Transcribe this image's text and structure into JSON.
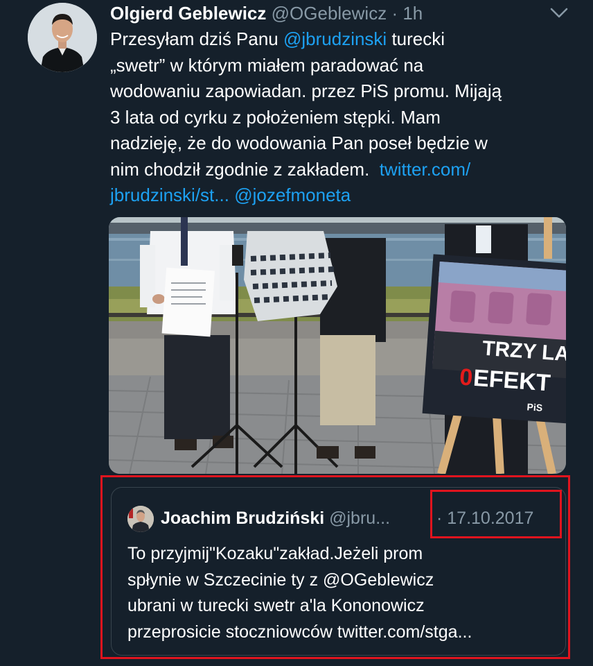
{
  "tweet": {
    "display_name": "Olgierd Geblewicz",
    "handle": "@OGeblewicz",
    "separator": "·",
    "time": "1h",
    "lines": [
      {
        "parts": [
          {
            "text": "Przesyłam dziś Panu ",
            "link": false
          },
          {
            "text": "@jbrudzinski",
            "link": true
          },
          {
            "text": " turecki",
            "link": false
          }
        ]
      },
      {
        "parts": [
          {
            "text": "„swetr” w którym miałem paradować na",
            "link": false
          }
        ]
      },
      {
        "parts": [
          {
            "text": "wodowaniu zapowiadan. przez PiS promu. Mijają",
            "link": false
          }
        ]
      },
      {
        "parts": [
          {
            "text": "3 lata od cyrku z położeniem stępki. Mam",
            "link": false
          }
        ]
      },
      {
        "parts": [
          {
            "text": "nadzieję, że do wodowania Pan poseł będzie w",
            "link": false
          }
        ]
      },
      {
        "parts": [
          {
            "text": "nim chodził zgodnie z zakładem.  ",
            "link": false
          },
          {
            "text": "twitter.com/",
            "link": true
          }
        ]
      },
      {
        "parts": [
          {
            "text": "jbrudzinski/st...",
            "link": true
          },
          {
            "text": " ",
            "link": false
          },
          {
            "text": "@jozefmoneta",
            "link": true
          }
        ]
      }
    ]
  },
  "media": {
    "sign_line1": "TRZY LA",
    "sign_line2_number": "0",
    "sign_line2_text": " EFEKT",
    "sign_logo": "PiS"
  },
  "quote": {
    "display_name": "Joachim Brudziński",
    "handle": "@jbru...",
    "date": "· 17.10.2017",
    "lines": [
      "To przyjmij\"Kozaku\"zakład.Jeżeli prom",
      "spłynie w Szczecinie ty z @OGeblewicz",
      "ubrani w turecki swetr a'la Kononowicz",
      "przeprosicie stoczniowców twitter.com/stga..."
    ]
  },
  "colors": {
    "background": "#15202b",
    "text": "#ffffff",
    "secondary": "#8899a6",
    "link": "#1da1f2",
    "highlight": "#e0141e",
    "card_border": "#38444d"
  },
  "icons": {
    "caret": "chevron-down-icon"
  }
}
